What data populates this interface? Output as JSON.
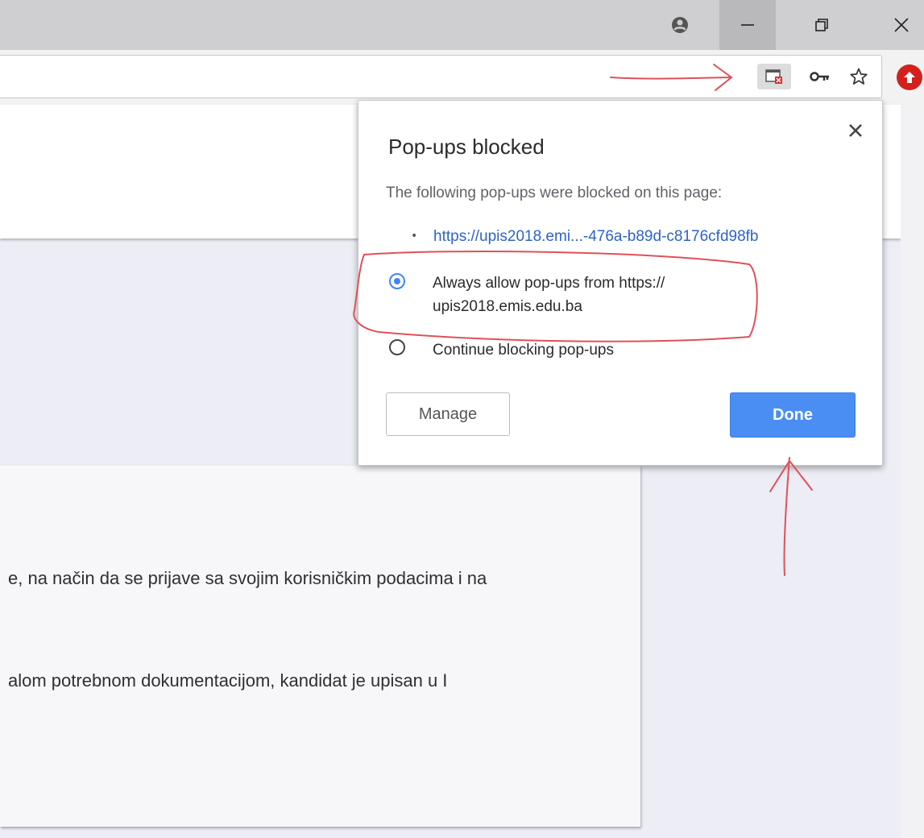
{
  "window": {
    "icons": {
      "account": "account-circle-icon",
      "minimize": "minimize-icon",
      "restore": "restore-icon",
      "close": "close-icon"
    }
  },
  "toolbar": {
    "icons": {
      "popup_blocked": "popup-blocked-icon",
      "password": "key-icon",
      "bookmark": "star-icon",
      "extension": "extension-icon"
    }
  },
  "popup_bubble": {
    "title": "Pop-ups blocked",
    "subtitle": "The following pop-ups were blocked on this page:",
    "blocked_link": "https://upis2018.emi...-476a-b89d-c8176cfd98fb",
    "options": [
      {
        "label": "Always allow pop-ups from https:// upis2018.emis.edu.ba",
        "selected": true
      },
      {
        "label": "Continue blocking pop-ups",
        "selected": false
      }
    ],
    "manage_label": "Manage",
    "done_label": "Done",
    "accent_color": "#4285f4"
  },
  "page": {
    "text_lines": [
      "e, na način da se prijave sa svojim korisničkim podacima i na",
      "alom potrebnom dokumentacijom, kandidat je upisan u I"
    ]
  },
  "annotation_color": "#e0505a"
}
